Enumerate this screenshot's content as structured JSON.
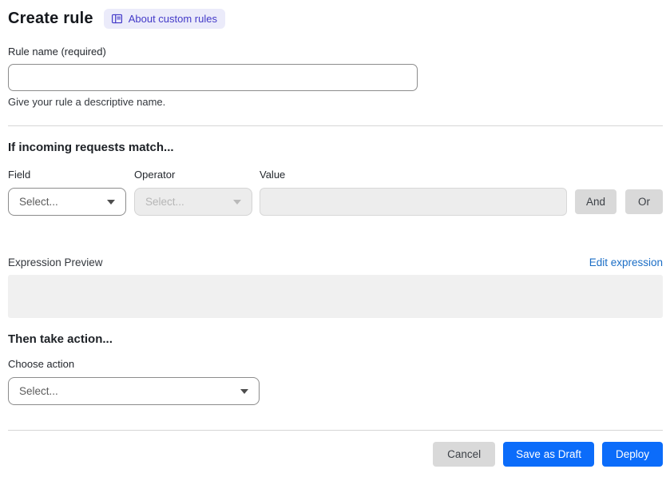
{
  "header": {
    "title": "Create rule",
    "about_link": "About custom rules"
  },
  "rule_name": {
    "label": "Rule name (required)",
    "value": "",
    "helper": "Give your rule a descriptive name."
  },
  "match": {
    "heading": "If incoming requests match...",
    "field": {
      "label": "Field",
      "placeholder": "Select..."
    },
    "operator": {
      "label": "Operator",
      "placeholder": "Select...",
      "disabled": true
    },
    "value": {
      "label": "Value",
      "value": "",
      "disabled": true
    },
    "and_label": "And",
    "or_label": "Or"
  },
  "expression": {
    "label": "Expression Preview",
    "edit_link": "Edit expression",
    "content": ""
  },
  "action": {
    "heading": "Then take action...",
    "choose_label": "Choose action",
    "placeholder": "Select..."
  },
  "footer": {
    "cancel": "Cancel",
    "save_draft": "Save as Draft",
    "deploy": "Deploy"
  },
  "icons": {
    "about_badge": "book-icon",
    "dropdown": "chevron-down-icon"
  },
  "colors": {
    "primary_button_blue": "#0b6cfa",
    "link_blue": "#1b6ec6",
    "badge_bg": "#ebebfa",
    "badge_text": "#4239c8",
    "disabled_bg": "#ececec",
    "gray_button": "#d9d9d9",
    "preview_bg": "#f0f0f0"
  }
}
